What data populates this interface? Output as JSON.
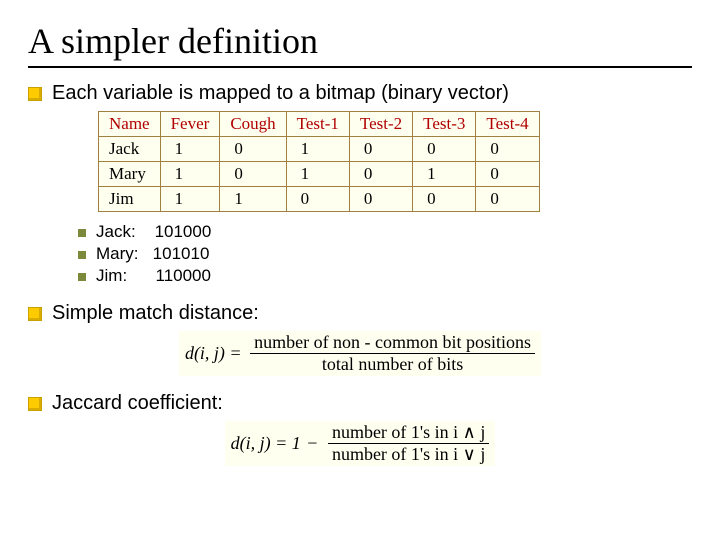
{
  "title": "A simpler definition",
  "bullets": {
    "map": "Each variable is mapped to a bitmap (binary vector)",
    "simple_match": "Simple match distance:",
    "jaccard": "Jaccard coefficient:"
  },
  "table": {
    "headers": [
      "Name",
      "Fever",
      "Cough",
      "Test-1",
      "Test-2",
      "Test-3",
      "Test-4"
    ],
    "rows": [
      [
        "Jack",
        "1",
        "0",
        "1",
        "0",
        "0",
        "0"
      ],
      [
        "Mary",
        "1",
        "0",
        "1",
        "0",
        "1",
        "0"
      ],
      [
        "Jim",
        "1",
        "1",
        "0",
        "0",
        "0",
        "0"
      ]
    ]
  },
  "bitmaps": {
    "jack": "Jack:    101000",
    "mary": "Mary:   101010",
    "jim": "Jim:      110000"
  },
  "formula_simple": {
    "lead": "d(i, j) = ",
    "num": "number of non - common bit positions",
    "den": "total number of bits"
  },
  "formula_jaccard": {
    "lead": "d(i, j) = 1",
    "minus": "−",
    "num": "number of 1's in i ∧ j",
    "den": "number of 1's in i ∨ j"
  },
  "chart_data": {
    "type": "table",
    "headers": [
      "Name",
      "Fever",
      "Cough",
      "Test-1",
      "Test-2",
      "Test-3",
      "Test-4"
    ],
    "rows": [
      {
        "Name": "Jack",
        "Fever": 1,
        "Cough": 0,
        "Test-1": 1,
        "Test-2": 0,
        "Test-3": 0,
        "Test-4": 0
      },
      {
        "Name": "Mary",
        "Fever": 1,
        "Cough": 0,
        "Test-1": 1,
        "Test-2": 0,
        "Test-3": 1,
        "Test-4": 0
      },
      {
        "Name": "Jim",
        "Fever": 1,
        "Cough": 1,
        "Test-1": 0,
        "Test-2": 0,
        "Test-3": 0,
        "Test-4": 0
      }
    ]
  }
}
